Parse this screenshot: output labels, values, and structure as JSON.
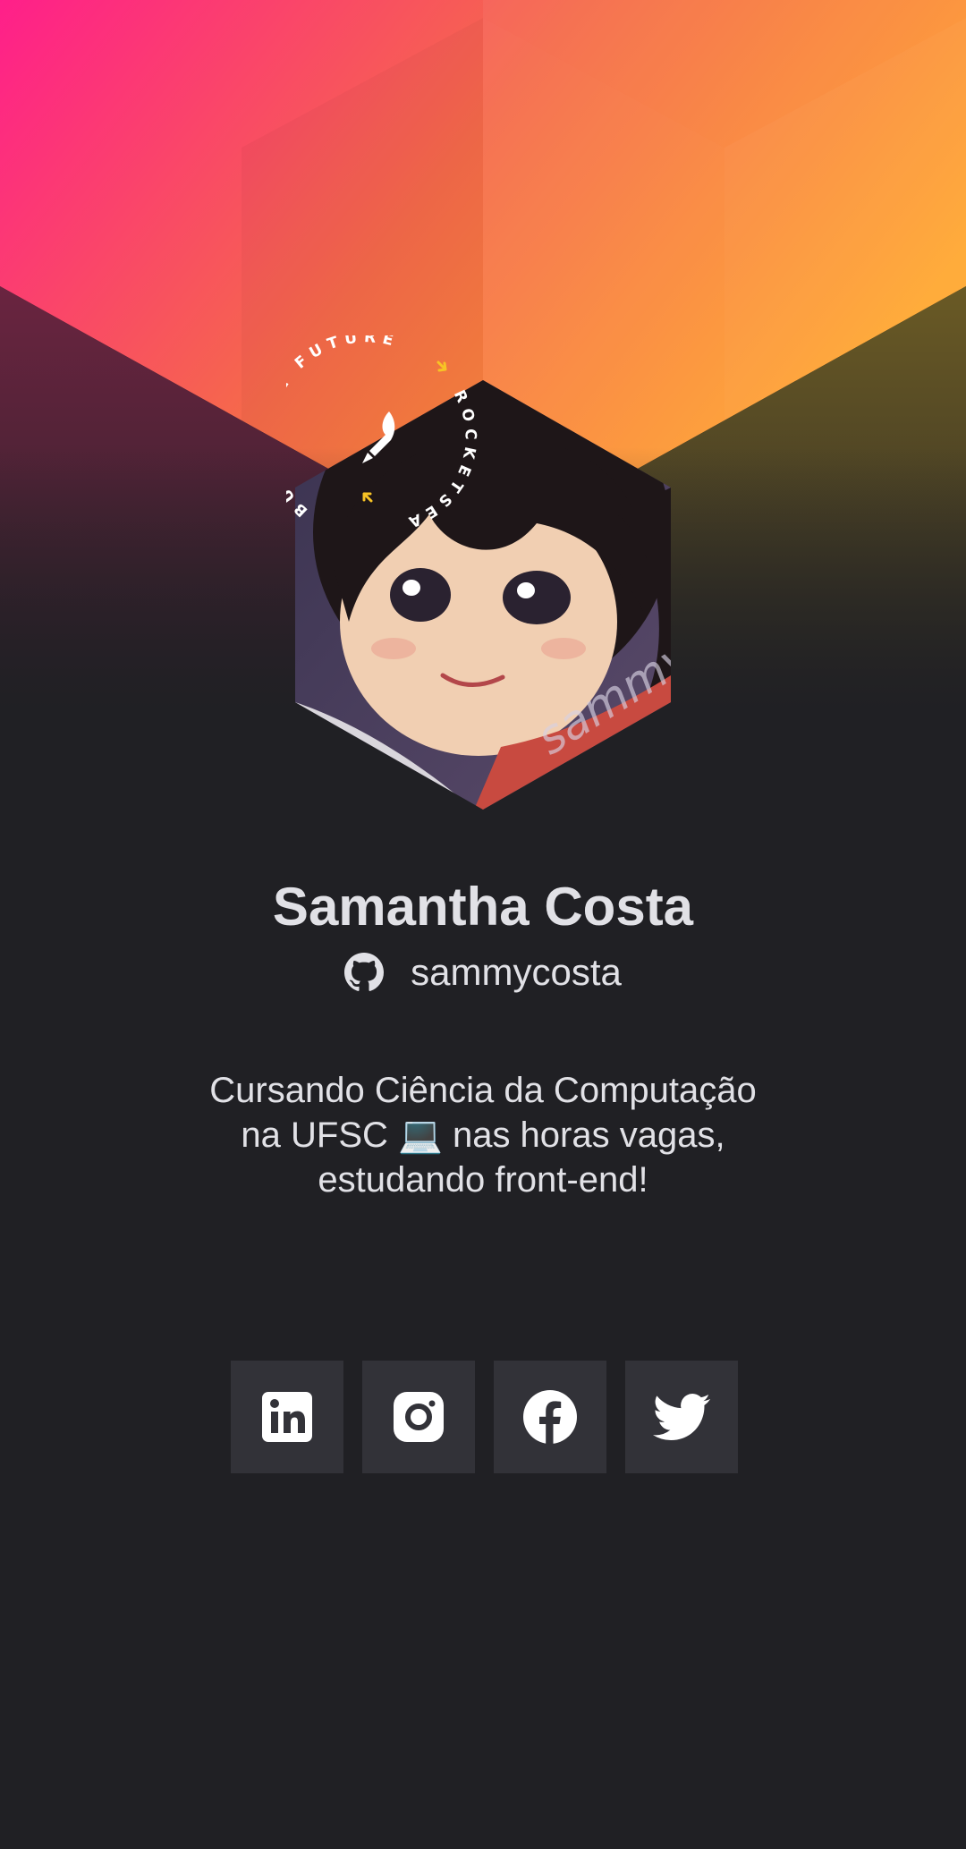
{
  "profile": {
    "name": "Samantha Costa",
    "github_username": "sammycosta",
    "bio_lines": [
      "Cursando Ciência da Computação",
      "na UFSC 💻 nas horas vagas,",
      "estudando front-end!"
    ]
  },
  "badge": {
    "top_text": "BUILD THE FUTURE",
    "side_text": "ROCKETSEAT",
    "arrow_color": "#f7c325"
  },
  "avatar": {
    "signature": "sammy"
  },
  "socials": [
    {
      "name": "LinkedIn",
      "icon": "linkedin-icon"
    },
    {
      "name": "Instagram",
      "icon": "instagram-icon"
    },
    {
      "name": "Facebook",
      "icon": "facebook-icon"
    },
    {
      "name": "Twitter",
      "icon": "twitter-icon"
    }
  ],
  "theme": {
    "background": "#202024",
    "button_bg": "#323238",
    "text": "#e1e1e6",
    "gradient_start": "#ff1f8a",
    "gradient_end": "#ffa52b"
  }
}
